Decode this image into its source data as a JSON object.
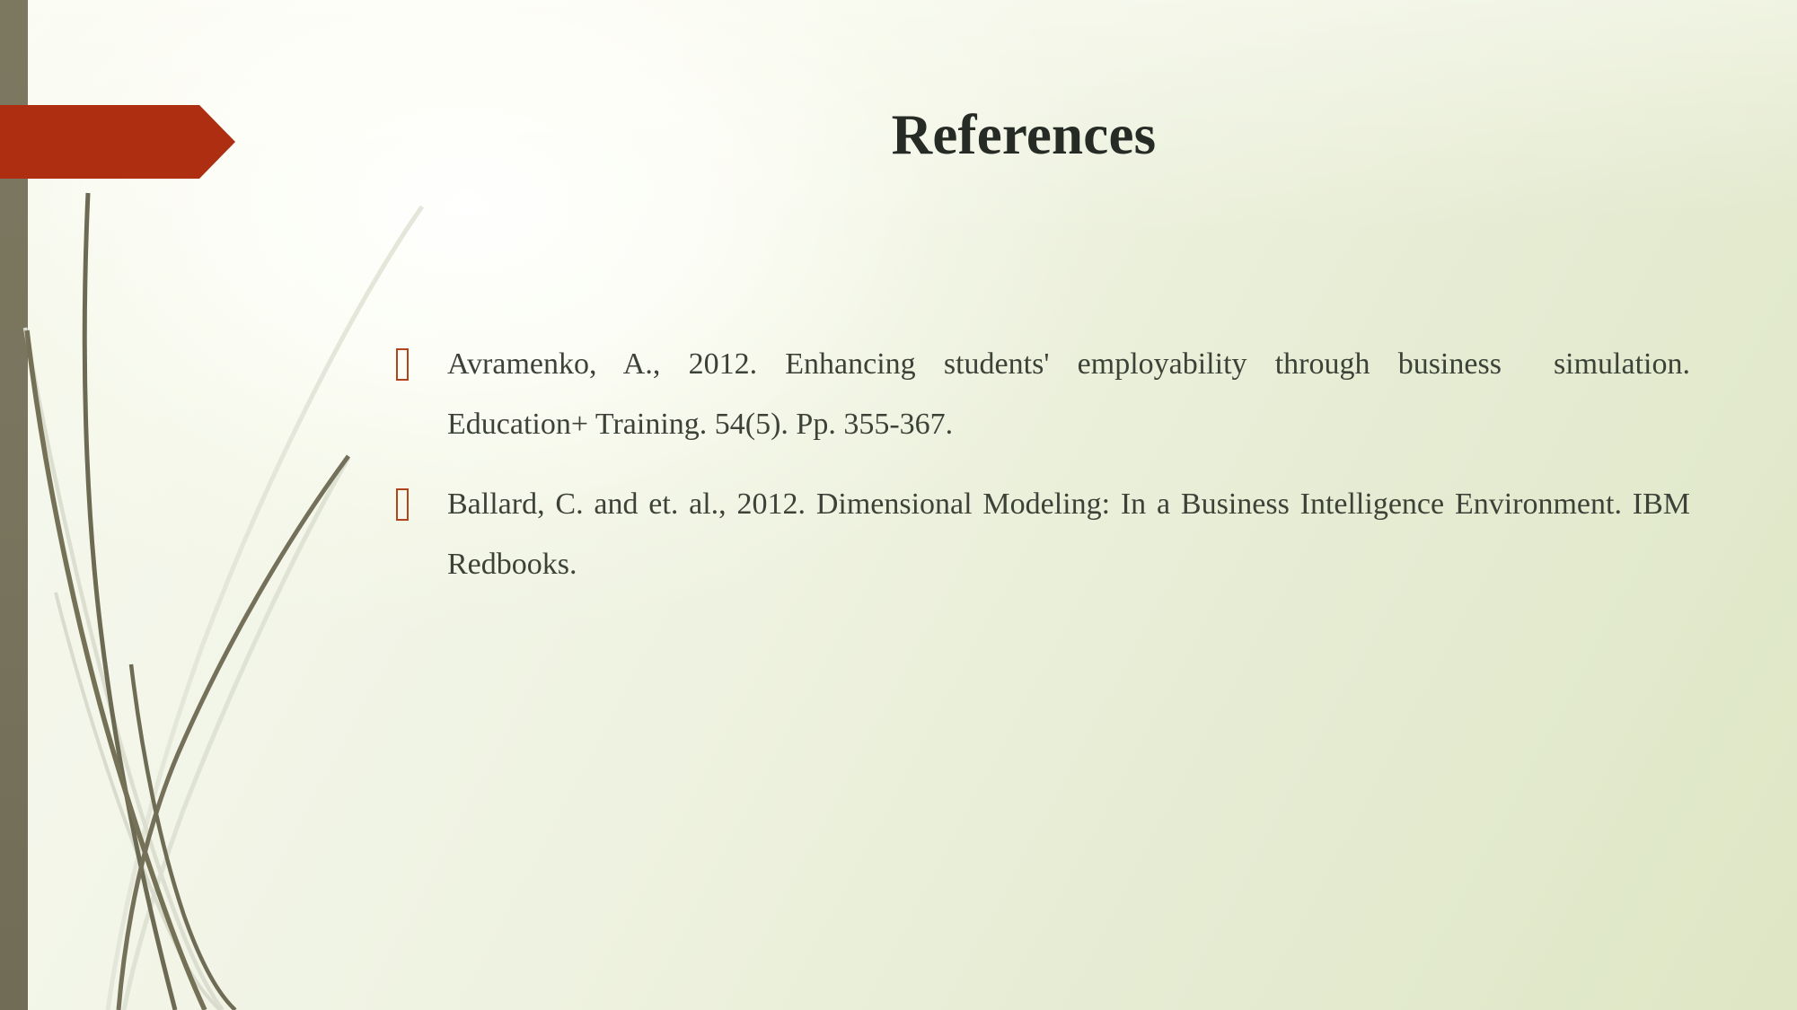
{
  "slide": {
    "title": "References",
    "theme": {
      "accent_red": "#AE2E12",
      "olive_bar": "#78745D",
      "bullet_color": "#B1441C",
      "text_color": "#3D4238",
      "title_color": "#262B25",
      "bg_light": "#F6F8EF",
      "bg_sage": "#DEE6C5"
    },
    "decor": {
      "banner": "red-arrow-banner",
      "left_bar": "olive-vertical-bar",
      "grass": "grass-stems-decoration"
    },
    "references": [
      {
        "bullet": "hollow-box-bullet",
        "line1_a": "Avramenko, A., 2012. Enhancing students' employability through business",
        "line1_b": "simulation.",
        "line2": "Education+ Training. 54(5). Pp. 355-367."
      },
      {
        "bullet": "hollow-box-bullet",
        "line1": "Ballard, C. and et. al., 2012. Dimensional Modeling: In a Business Intelligence",
        "line2": "Environment. IBM Redbooks."
      }
    ]
  }
}
